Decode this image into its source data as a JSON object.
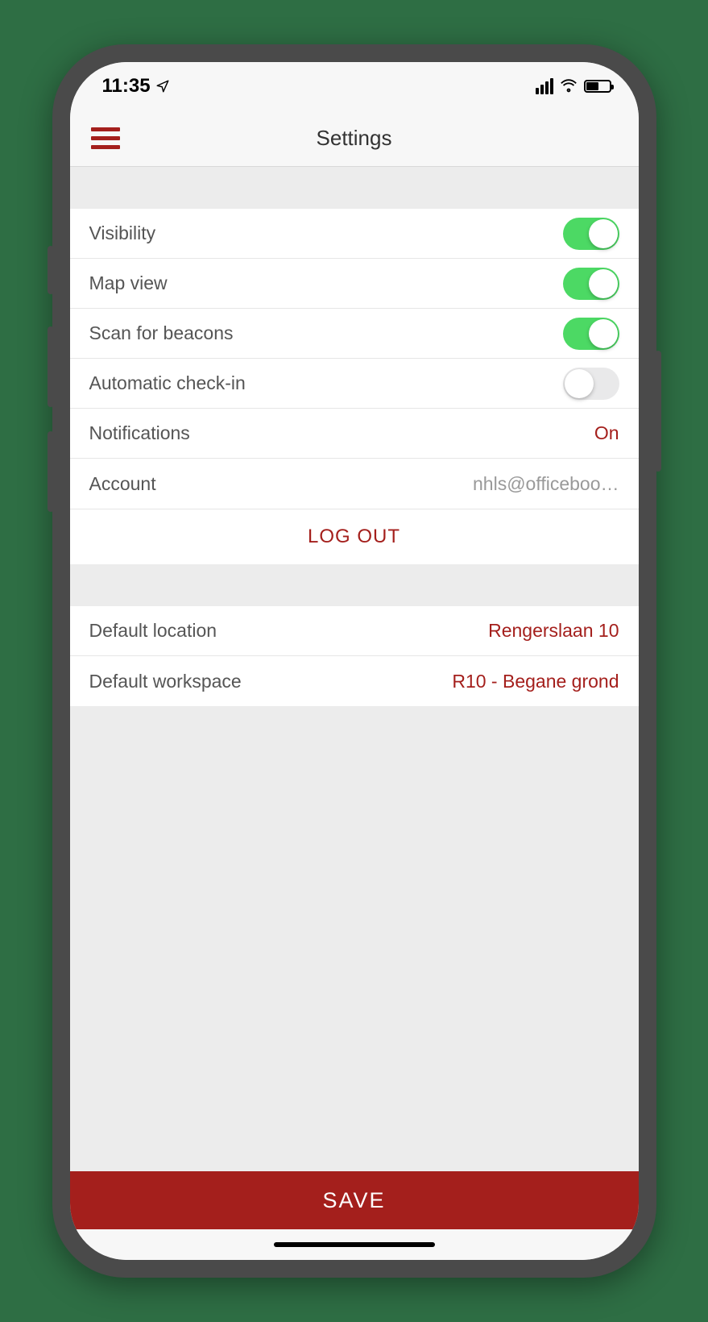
{
  "status": {
    "time": "11:35"
  },
  "header": {
    "title": "Settings"
  },
  "settings": {
    "visibility": {
      "label": "Visibility",
      "on": true
    },
    "map_view": {
      "label": "Map view",
      "on": true
    },
    "beacons": {
      "label": "Scan for beacons",
      "on": true
    },
    "auto_checkin": {
      "label": "Automatic check-in",
      "on": false
    },
    "notifications": {
      "label": "Notifications",
      "value": "On"
    },
    "account": {
      "label": "Account",
      "value": "nhls@officeboo…"
    },
    "logout_label": "LOG OUT"
  },
  "defaults": {
    "location": {
      "label": "Default location",
      "value": "Rengerslaan 10"
    },
    "workspace": {
      "label": "Default workspace",
      "value": "R10 - Begane grond"
    }
  },
  "save_label": "SAVE",
  "colors": {
    "accent": "#a41f1c",
    "toggle_on": "#4cd964"
  }
}
